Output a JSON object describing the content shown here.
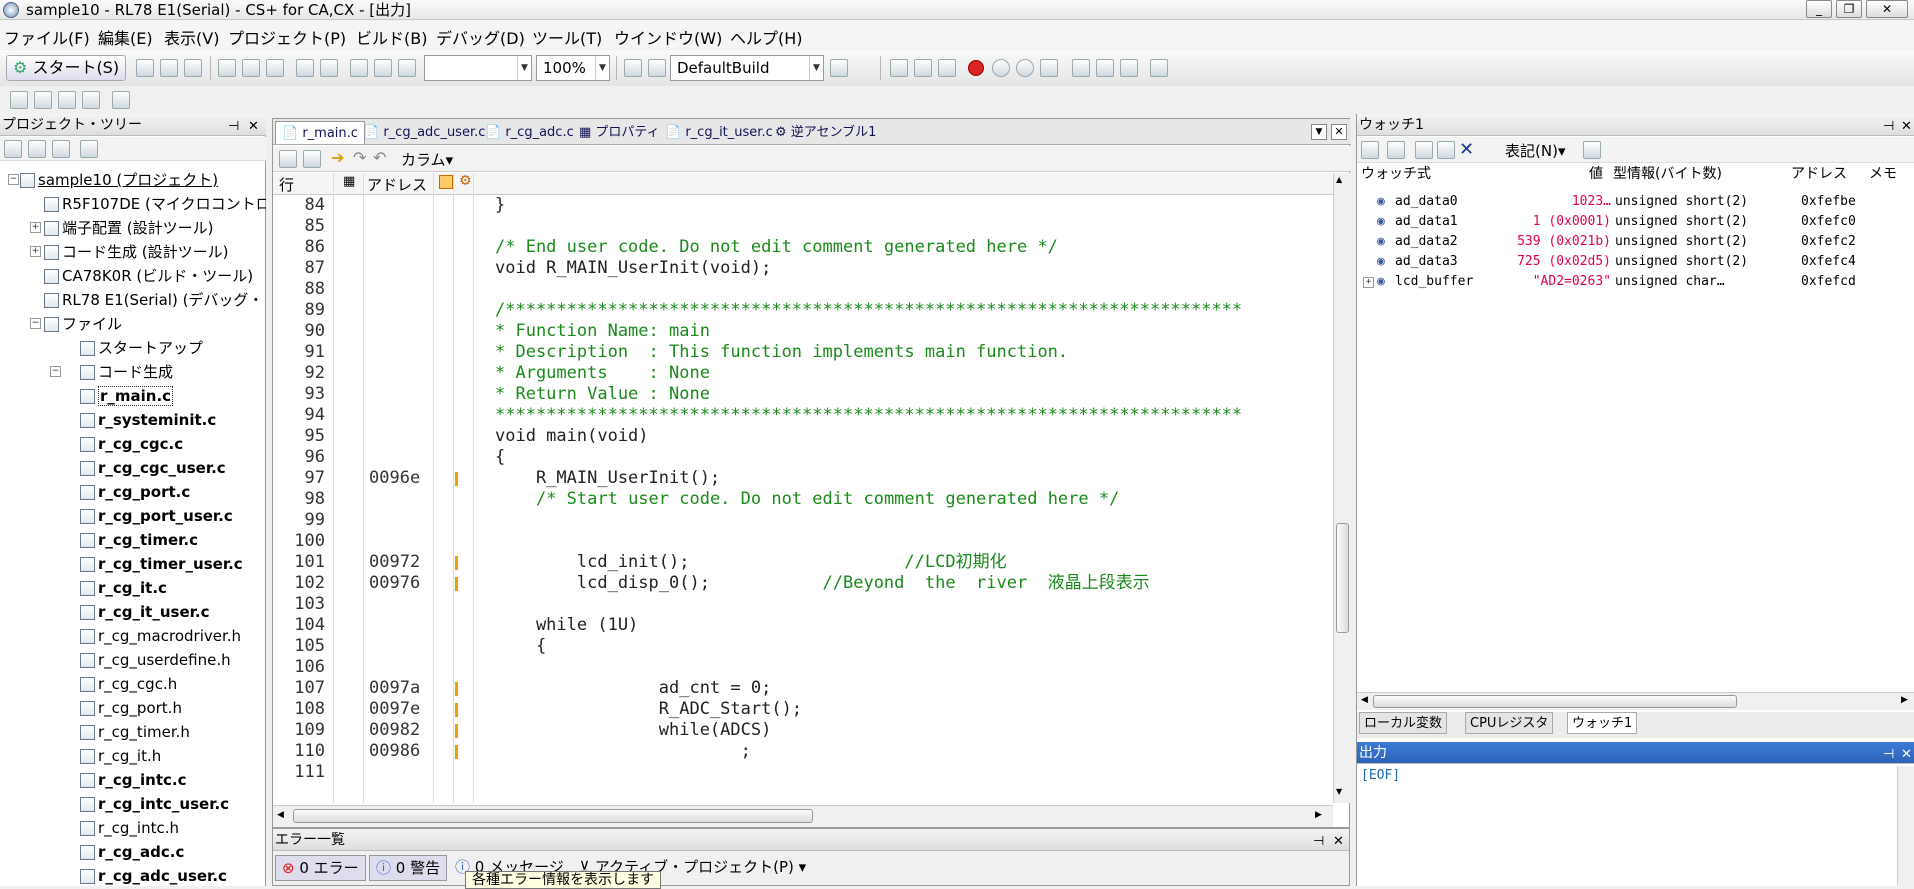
{
  "window": {
    "title": "sample10 - RL78 E1(Serial) - CS+ for CA,CX - [出力]"
  },
  "menu": [
    "ファイル(F)",
    "編集(E)",
    "表示(V)",
    "プロジェクト(P)",
    "ビルド(B)",
    "デバッグ(D)",
    "ツール(T)",
    "ウインドウ(W)",
    "ヘルプ(H)"
  ],
  "toolbar": {
    "start_label": "スタート(S)",
    "zoom": "100%",
    "build_mode": "DefaultBuild",
    "search_value": ""
  },
  "project_tree": {
    "title": "プロジェクト・ツリー",
    "root": "sample10 (プロジェクト)",
    "nodes": [
      "R5F107DE (マイクロコントロ",
      "端子配置 (設計ツール)",
      "コード生成 (設計ツール)",
      "CA78K0R (ビルド・ツール)",
      "RL78 E1(Serial) (デバッグ・",
      "ファイル",
      "スタートアップ",
      "コード生成"
    ],
    "files": [
      "r_main.c",
      "r_systeminit.c",
      "r_cg_cgc.c",
      "r_cg_cgc_user.c",
      "r_cg_port.c",
      "r_cg_port_user.c",
      "r_cg_timer.c",
      "r_cg_timer_user.c",
      "r_cg_it.c",
      "r_cg_it_user.c",
      "r_cg_macrodriver.h",
      "r_cg_userdefine.h",
      "r_cg_cgc.h",
      "r_cg_port.h",
      "r_cg_timer.h",
      "r_cg_it.h",
      "r_cg_intc.c",
      "r_cg_intc_user.c",
      "r_cg_intc.h",
      "r_cg_adc.c",
      "r_cg_adc_user.c"
    ]
  },
  "editor": {
    "tabs": [
      "r_main.c",
      "r_cg_adc_user.c",
      "r_cg_adc.c",
      "プロパティ",
      "r_cg_it_user.c",
      "逆アセンブル1"
    ],
    "toolbar_label": "カラム",
    "col_line": "行",
    "col_address": "アドレス",
    "lines": [
      {
        "n": "84",
        "addr": "",
        "bp": false,
        "code": "}",
        "comment": ""
      },
      {
        "n": "85",
        "addr": "",
        "bp": false,
        "code": "",
        "comment": ""
      },
      {
        "n": "86",
        "addr": "",
        "bp": false,
        "code": "",
        "comment": "/* End user code. Do not edit comment generated here */"
      },
      {
        "n": "87",
        "addr": "",
        "bp": false,
        "code": "void R_MAIN_UserInit(void);",
        "comment": ""
      },
      {
        "n": "88",
        "addr": "",
        "bp": false,
        "code": "",
        "comment": ""
      },
      {
        "n": "89",
        "addr": "",
        "bp": false,
        "code": "",
        "comment": "/************************************************************************"
      },
      {
        "n": "90",
        "addr": "",
        "bp": false,
        "code": "",
        "comment": "* Function Name: main"
      },
      {
        "n": "91",
        "addr": "",
        "bp": false,
        "code": "",
        "comment": "* Description  : This function implements main function."
      },
      {
        "n": "92",
        "addr": "",
        "bp": false,
        "code": "",
        "comment": "* Arguments    : None"
      },
      {
        "n": "93",
        "addr": "",
        "bp": false,
        "code": "",
        "comment": "* Return Value : None"
      },
      {
        "n": "94",
        "addr": "",
        "bp": false,
        "code": "",
        "comment": "*************************************************************************"
      },
      {
        "n": "95",
        "addr": "",
        "bp": false,
        "code": "void main(void)",
        "comment": ""
      },
      {
        "n": "96",
        "addr": "",
        "bp": false,
        "code": "{",
        "comment": ""
      },
      {
        "n": "97",
        "addr": "0096e",
        "bp": true,
        "code": "    R_MAIN_UserInit();",
        "comment": ""
      },
      {
        "n": "98",
        "addr": "",
        "bp": false,
        "code": "    ",
        "comment": "/* Start user code. Do not edit comment generated here */"
      },
      {
        "n": "99",
        "addr": "",
        "bp": false,
        "code": "",
        "comment": ""
      },
      {
        "n": "100",
        "addr": "",
        "bp": false,
        "code": "",
        "comment": ""
      },
      {
        "n": "101",
        "addr": "00972",
        "bp": true,
        "code": "        lcd_init();                     ",
        "comment": "//LCD初期化"
      },
      {
        "n": "102",
        "addr": "00976",
        "bp": true,
        "code": "        lcd_disp_0();           ",
        "comment": "//Beyond  the  river  液晶上段表示"
      },
      {
        "n": "103",
        "addr": "",
        "bp": false,
        "code": "",
        "comment": ""
      },
      {
        "n": "104",
        "addr": "",
        "bp": false,
        "code": "    while (1U)",
        "comment": ""
      },
      {
        "n": "105",
        "addr": "",
        "bp": false,
        "code": "    {",
        "comment": ""
      },
      {
        "n": "106",
        "addr": "",
        "bp": false,
        "code": "",
        "comment": ""
      },
      {
        "n": "107",
        "addr": "0097a",
        "bp": true,
        "code": "                ad_cnt = 0;",
        "comment": ""
      },
      {
        "n": "108",
        "addr": "0097e",
        "bp": true,
        "code": "                R_ADC_Start();",
        "comment": ""
      },
      {
        "n": "109",
        "addr": "00982",
        "bp": true,
        "code": "                while(ADCS)",
        "comment": ""
      },
      {
        "n": "110",
        "addr": "00986",
        "bp": true,
        "code": "                        ;",
        "comment": ""
      },
      {
        "n": "111",
        "addr": "",
        "bp": false,
        "code": "",
        "comment": ""
      }
    ]
  },
  "error_list": {
    "title": "エラー一覧",
    "errors": "0 エラー",
    "warnings": "0 警告",
    "messages": "0 メッセージ",
    "scope": "アクティブ・プロジェクト(P)",
    "tooltip": "各種エラー情報を表示します"
  },
  "watch": {
    "title": "ウォッチ1",
    "notation": "表記(N)",
    "headers": {
      "expr": "ウォッチ式",
      "value": "値",
      "type": "型情報(バイト数)",
      "addr": "アドレス",
      "memo": "メモ"
    },
    "rows": [
      {
        "name": "ad_data0",
        "value": "1023…",
        "type": "unsigned short(2)",
        "addr": "0xfefbe"
      },
      {
        "name": "ad_data1",
        "value": "1 (0x0001)",
        "type": "unsigned short(2)",
        "addr": "0xfefc0"
      },
      {
        "name": "ad_data2",
        "value": "539 (0x021b)",
        "type": "unsigned short(2)",
        "addr": "0xfefc2"
      },
      {
        "name": "ad_data3",
        "value": "725 (0x02d5)",
        "type": "unsigned short(2)",
        "addr": "0xfefc4"
      },
      {
        "name": "lcd_buffer",
        "value": "\"AD2=0263\"",
        "type": "unsigned char…",
        "addr": "0xfefcd"
      }
    ],
    "bottom_tabs": [
      "ローカル変数",
      "CPUレジスタ",
      "ウォッチ1"
    ]
  },
  "output": {
    "title": "出力",
    "text": "[EOF]"
  },
  "colors": {
    "comment": "#1a8a1a",
    "watch_value": "#e0004c",
    "breakpoint": "#f2a000",
    "output_text": "#1a6ab0"
  }
}
